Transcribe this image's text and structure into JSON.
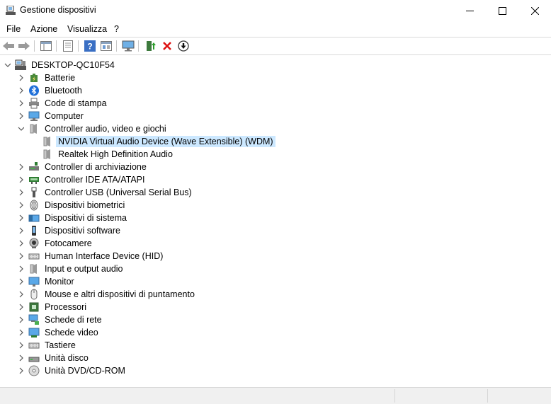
{
  "window": {
    "title": "Gestione dispositivi"
  },
  "menu": [
    "File",
    "Azione",
    "Visualizza",
    "?"
  ],
  "toolbar": [
    "back-icon",
    "forward-icon",
    "show-hide-tree-icon",
    "properties-icon",
    "help-icon",
    "view-resources-icon",
    "scan-hardware-icon",
    "update-driver-icon",
    "uninstall-icon",
    "disable-device-icon"
  ],
  "tree": {
    "root": "DESKTOP-QC10F54",
    "categories": [
      {
        "label": "Batterie",
        "icon": "battery-icon"
      },
      {
        "label": "Bluetooth",
        "icon": "bluetooth-icon"
      },
      {
        "label": "Code di stampa",
        "icon": "printer-icon"
      },
      {
        "label": "Computer",
        "icon": "computer-icon"
      },
      {
        "label": "Controller audio, video e giochi",
        "icon": "speaker-icon",
        "expanded": true,
        "children": [
          {
            "label": "NVIDIA Virtual Audio Device (Wave Extensible) (WDM)",
            "icon": "speaker-icon",
            "selected": true
          },
          {
            "label": "Realtek High Definition Audio",
            "icon": "speaker-icon"
          }
        ]
      },
      {
        "label": "Controller di archiviazione",
        "icon": "storage-controller-icon"
      },
      {
        "label": "Controller IDE ATA/ATAPI",
        "icon": "ide-icon"
      },
      {
        "label": "Controller USB (Universal Serial Bus)",
        "icon": "usb-icon"
      },
      {
        "label": "Dispositivi biometrici",
        "icon": "fingerprint-icon"
      },
      {
        "label": "Dispositivi di sistema",
        "icon": "system-device-icon"
      },
      {
        "label": "Dispositivi software",
        "icon": "software-device-icon"
      },
      {
        "label": "Fotocamere",
        "icon": "camera-icon"
      },
      {
        "label": "Human Interface Device (HID)",
        "icon": "keyboard-icon"
      },
      {
        "label": "Input e output audio",
        "icon": "speaker-icon"
      },
      {
        "label": "Monitor",
        "icon": "monitor-icon"
      },
      {
        "label": "Mouse e altri dispositivi di puntamento",
        "icon": "mouse-icon"
      },
      {
        "label": "Processori",
        "icon": "processor-icon"
      },
      {
        "label": "Schede di rete",
        "icon": "network-icon"
      },
      {
        "label": "Schede video",
        "icon": "display-adapter-icon"
      },
      {
        "label": "Tastiere",
        "icon": "keyboard-icon"
      },
      {
        "label": "Unità disco",
        "icon": "disk-icon"
      },
      {
        "label": "Unità DVD/CD-ROM",
        "icon": "dvd-icon"
      }
    ]
  },
  "colors": {
    "selection": "#cce8ff",
    "separator": "#d9d9d9",
    "statusbar": "#f0f0f0"
  }
}
